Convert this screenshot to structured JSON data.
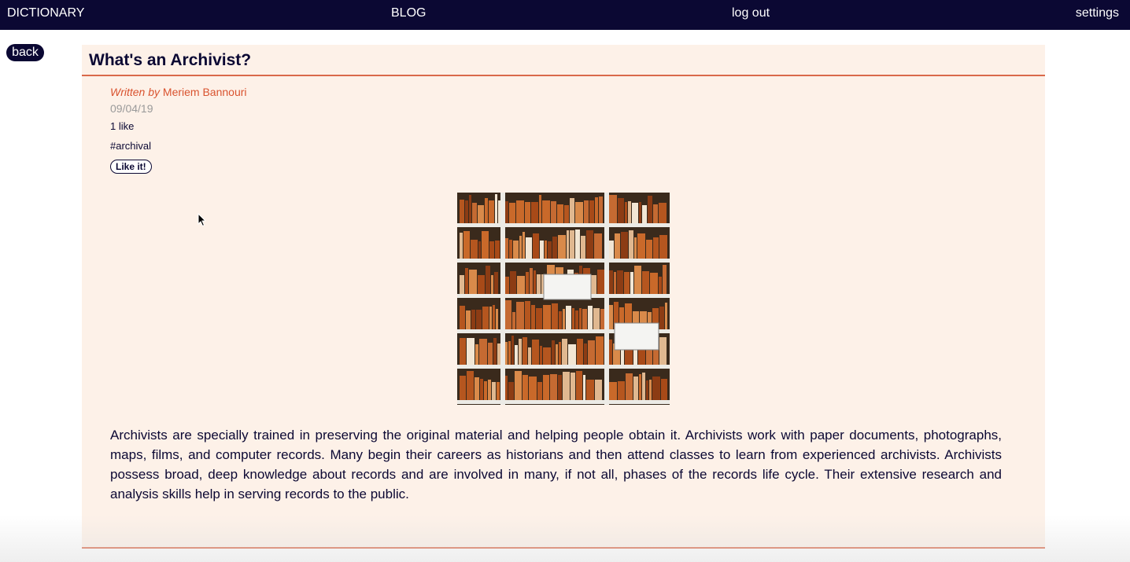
{
  "nav": {
    "dictionary": "DICTIONARY",
    "blog": "BLOG",
    "logout": "log out",
    "settings": "settings"
  },
  "back_label": "back",
  "article": {
    "title": "What's an Archivist?",
    "written_by_prefix": "Written by",
    "author": "Meriem Bannouri",
    "date": "09/04/19",
    "likes": "1 like",
    "tag": "#archival",
    "like_button": "Like it!",
    "image_subject": "archive shelves with file folders",
    "body": "Archivists are specially trained in preserving the original material and helping people obtain it. Archivists work with paper documents, photographs, maps, films, and computer records. Many begin their careers as historians and then attend classes to learn from experienced archivists. Archivists possess broad, deep knowledge about records and are involved in many, if not all, phases of the records life cycle. Their extensive research and analysis skills help in serving records to the public."
  },
  "colors": {
    "nav_bg": "#0b0833",
    "card_bg": "#fdf1e8",
    "accent": "#d9694a",
    "author": "#d9532f",
    "date": "#9a9a9a"
  }
}
